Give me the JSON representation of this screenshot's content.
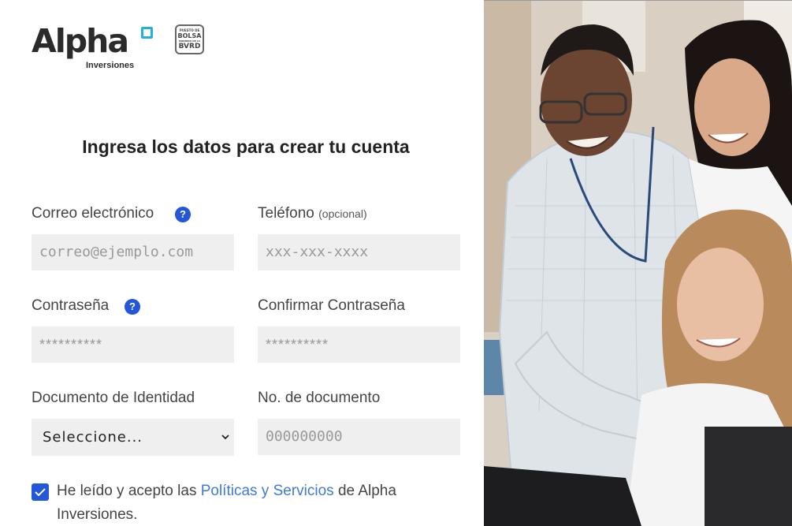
{
  "brand": {
    "name": "Alpha",
    "sub": "Inversiones",
    "badge_line1": "PUESTO DE",
    "badge_line2": "BOLSA",
    "badge_line3": "MIEMBRO DE LA",
    "badge_line4": "BVRD"
  },
  "heading": "Ingresa los datos para crear tu cuenta",
  "fields": {
    "email": {
      "label": "Correo electrónico",
      "placeholder": "correo@ejemplo.com"
    },
    "phone": {
      "label": "Teléfono",
      "label_hint": "(opcional)",
      "placeholder": "xxx-xxx-xxxx"
    },
    "password": {
      "label": "Contraseña",
      "placeholder": "**********"
    },
    "confirm_password": {
      "label": "Confirmar Contraseña",
      "placeholder": "**********"
    },
    "id_type": {
      "label": "Documento de Identidad",
      "selected": "Seleccione..."
    },
    "id_number": {
      "label": "No. de documento",
      "placeholder": "000000000"
    }
  },
  "help_glyph": "?",
  "terms": {
    "checked": true,
    "prefix": "He leído y acepto las ",
    "link": "Políticas y Servicios",
    "suffix": " de Alpha Inversiones."
  },
  "icons": {
    "help": "question-circle-icon",
    "check": "checkmark-icon",
    "chevron": "chevron-down-icon"
  },
  "colors": {
    "accent": "#2356d8",
    "link": "#3f7ad6",
    "logo_accent": "#23b0d9",
    "input_bg": "#efefef"
  }
}
